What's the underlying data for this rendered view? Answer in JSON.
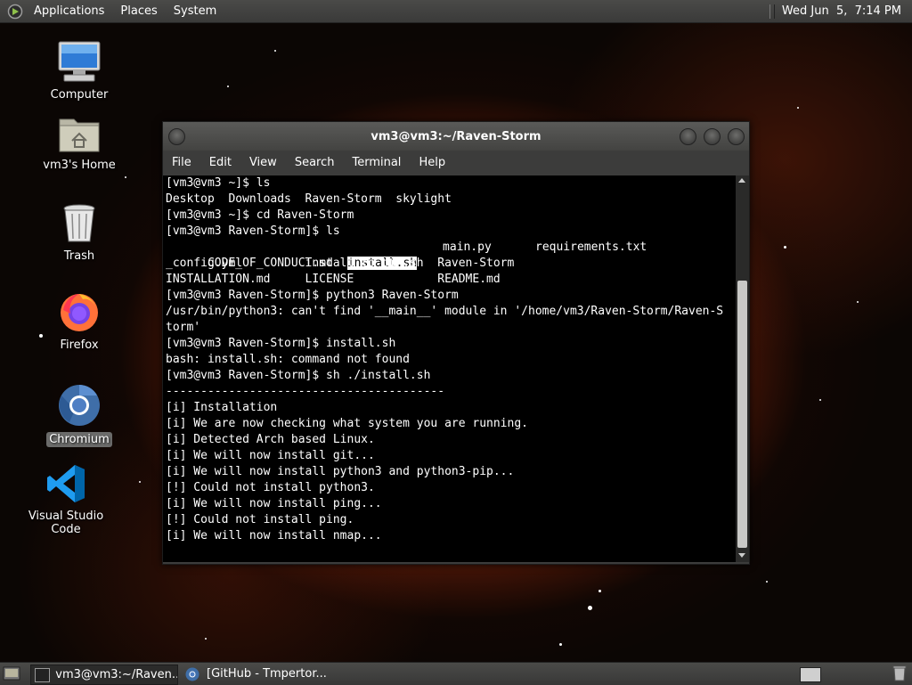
{
  "top_panel": {
    "menus": [
      "Applications",
      "Places",
      "System"
    ],
    "clock": "Wed Jun  5,  7:14 PM"
  },
  "desktop_icons": [
    {
      "label": "Computer",
      "icon": "computer-icon"
    },
    {
      "label": "vm3's Home",
      "icon": "home-folder-icon"
    },
    {
      "label": "Trash",
      "icon": "trash-icon"
    },
    {
      "label": "Firefox",
      "icon": "firefox-icon"
    },
    {
      "label": "Chromium",
      "icon": "chromium-icon"
    },
    {
      "label": "Visual Studio Code",
      "icon": "vscode-icon"
    }
  ],
  "terminal": {
    "title": "vm3@vm3:~/Raven-Storm",
    "menu": [
      "File",
      "Edit",
      "View",
      "Search",
      "Terminal",
      "Help"
    ],
    "lines": [
      "[vm3@vm3 ~]$ ls",
      "Desktop  Downloads  Raven-Storm  skylight",
      "[vm3@vm3 ~]$ cd Raven-Storm",
      "[vm3@vm3 Raven-Storm]$ ls",
      "",
      "_config.yml         install_to_bin.sh  Raven-Storm",
      "INSTALLATION.md     LICENSE            README.md",
      "[vm3@vm3 Raven-Storm]$ python3 Raven-Storm",
      "/usr/bin/python3: can't find '__main__' module in '/home/vm3/Raven-Storm/Raven-S",
      "torm'",
      "[vm3@vm3 Raven-Storm]$ install.sh",
      "bash: install.sh: command not found",
      "[vm3@vm3 Raven-Storm]$ sh ./install.sh",
      "----------------------------------------",
      "[i] Installation",
      "[i] We are now checking what system you are running.",
      "[i] Detected Arch based Linux.",
      "[i] We will now install git...",
      "[i] We will now install python3 and python3-pip...",
      "[!] Could not install python3.",
      "[i] We will now install ping...",
      "[!] Could not install ping.",
      "[i] We will now install nmap..."
    ],
    "ls_row1": {
      "a": "CODE_OF_CONDUCT.md",
      "highlight": "install.sh",
      "b": "main.py",
      "c": "requirements.txt"
    }
  },
  "taskbar": {
    "items": [
      "vm3@vm3:~/Raven...",
      "[GitHub - Tmpertor..."
    ]
  }
}
